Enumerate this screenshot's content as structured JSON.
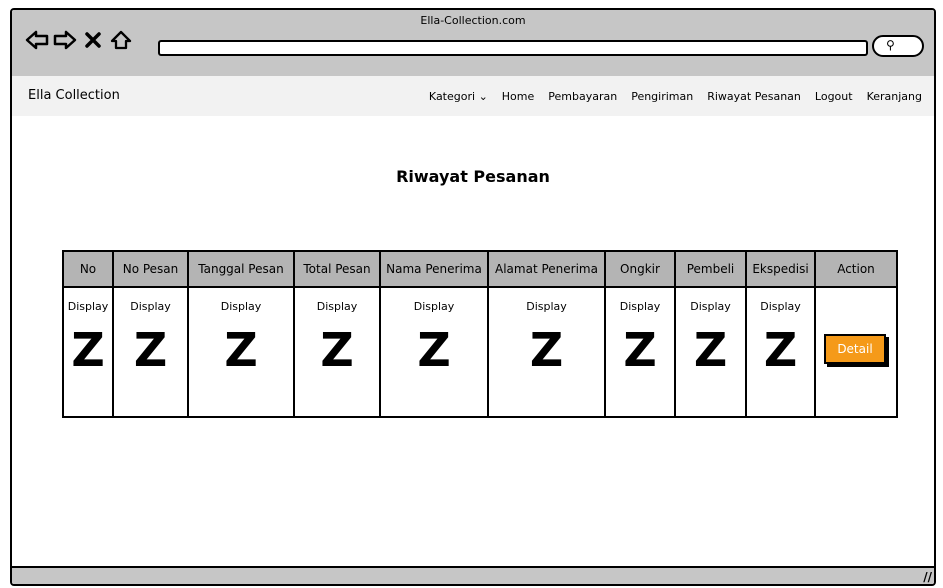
{
  "window": {
    "title": "Ella-Collection.com"
  },
  "navbar": {
    "brand": "Ella Collection",
    "items": [
      "Kategori",
      "Home",
      "Pembayaran",
      "Pengiriman",
      "Riwayat Pesanan",
      "Logout",
      "Keranjang"
    ]
  },
  "page": {
    "title": "Riwayat Pesanan"
  },
  "table": {
    "headers": [
      "No",
      "No Pesan",
      "Tanggal Pesan",
      "Total Pesan",
      "Nama Penerima",
      "Alamat Penerima",
      "Ongkir",
      "Pembeli",
      "Ekspedisi",
      "Action"
    ],
    "cell_label": "Display",
    "cell_value": "Z",
    "action_label": "Detail"
  },
  "colors": {
    "header_bg": "#b4b4b4",
    "action_button": "#f59a19",
    "chrome": "#c6c6c6"
  },
  "icons": [
    "back-icon",
    "forward-icon",
    "close-icon",
    "home-icon",
    "search-icon",
    "chevron-down-icon",
    "resize-icon"
  ]
}
